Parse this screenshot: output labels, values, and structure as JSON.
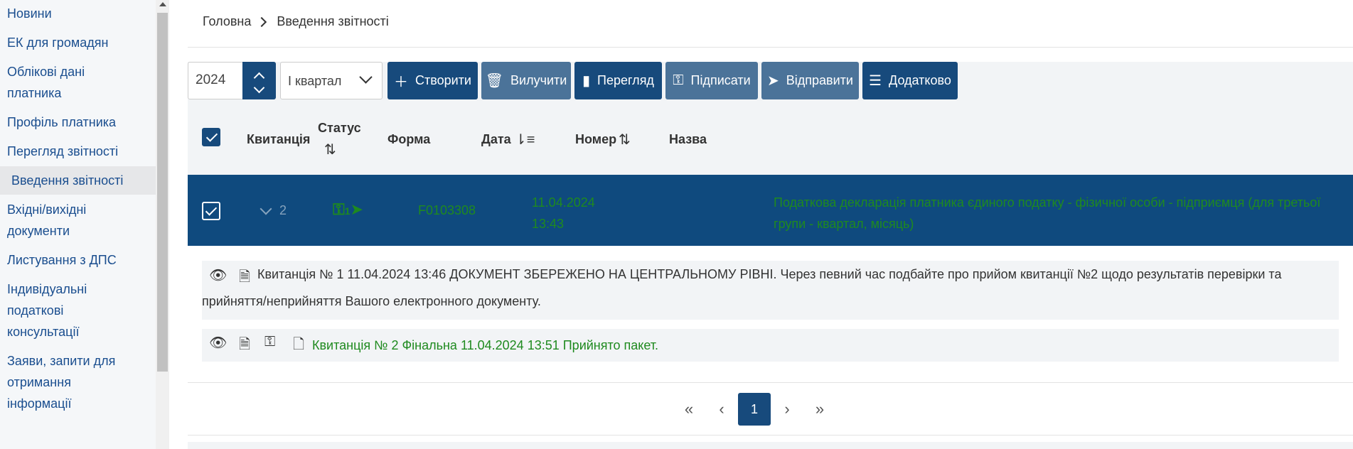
{
  "sidebar": {
    "items": [
      {
        "label": "Новини"
      },
      {
        "label": "ЕК для громадян"
      },
      {
        "label": "Облікові дані платника"
      },
      {
        "label": "Профіль платника"
      },
      {
        "label": "Перегляд звітності"
      },
      {
        "label": "Введення звітності",
        "active": true
      },
      {
        "label": "Вхідні/вихідні документи"
      },
      {
        "label": "Листування з ДПС"
      },
      {
        "label": "Індивідуальні податкові консультації"
      },
      {
        "label": "Заяви, запити для отримання інформації"
      }
    ]
  },
  "breadcrumb": {
    "home": "Головна",
    "current": "Введення звітності"
  },
  "toolbar": {
    "year": "2024",
    "quarter": "І квартал",
    "create": "Створити",
    "delete": "Вилучити",
    "view": "Перегляд",
    "sign": "Підписати",
    "send": "Відправити",
    "more": "Додатково"
  },
  "table": {
    "headers": {
      "receipt": "Квитанція",
      "status": "Статус",
      "form": "Форма",
      "date": "Дата",
      "number": "Номер",
      "name": "Назва"
    },
    "row": {
      "receipt_count": "2",
      "status_count": "1",
      "form": "F0103308",
      "date_line1": "11.04.2024",
      "date_line2": "13:43",
      "name": "Податкова декларація платника єдиного податку - фізичної особи - підприємця (для третьої групи - квартал, місяць)"
    }
  },
  "receipts": [
    {
      "text": "Квитанція № 1 11.04.2024 13:46 ДОКУМЕНТ ЗБЕРЕЖЕНО НА ЦЕНТРАЛЬНОМУ РІВНІ. Через певний час подбайте про прийом квитанції №2 щодо результатів перевірки та прийняття/неприйняття Вашого електронного документу."
    },
    {
      "text": "Квитанція № 2 Фінальна 11.04.2024 13:51 Прийнято пакет."
    }
  ],
  "pagination": {
    "first": "«",
    "prev": "‹",
    "current": "1",
    "next": "›",
    "last": "»"
  },
  "colors": {
    "primary": "#174a7c",
    "secondary": "#4b7399",
    "success": "#1f8a1f"
  }
}
